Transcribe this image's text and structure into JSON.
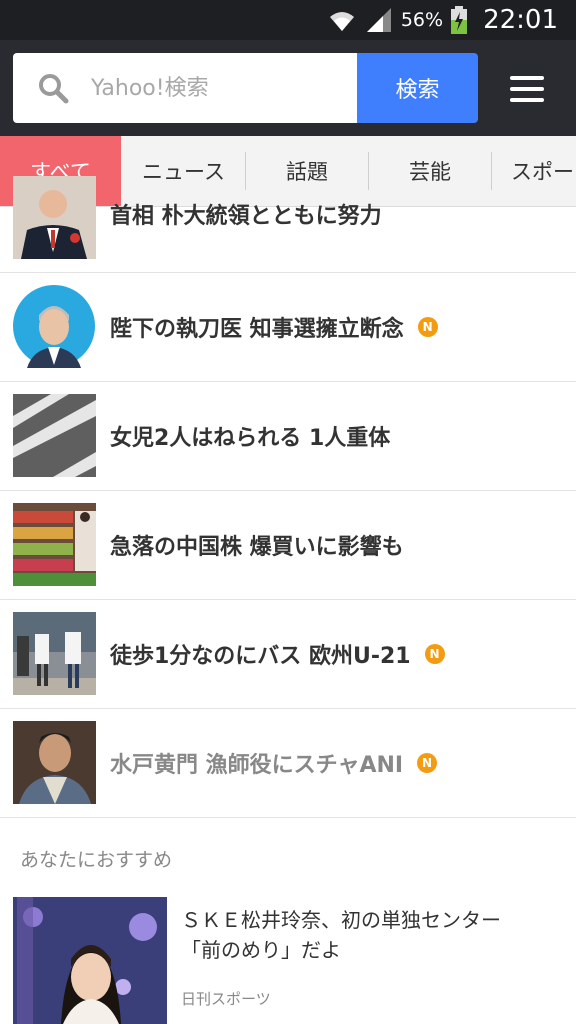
{
  "status_bar": {
    "battery_percent": "56%",
    "time": "22:01",
    "icons": [
      "wifi-icon",
      "signal-icon",
      "battery-charging-icon"
    ]
  },
  "search": {
    "placeholder": "Yahoo!検索",
    "value": "",
    "button_label": "検索"
  },
  "tabs": [
    {
      "label": "すべて",
      "active": true
    },
    {
      "label": "ニュース",
      "active": false
    },
    {
      "label": "話題",
      "active": false
    },
    {
      "label": "芸能",
      "active": false
    },
    {
      "label": "スポー",
      "active": false
    }
  ],
  "news": [
    {
      "title": "首相 朴大統領とともに努力",
      "is_new": false,
      "visited": false
    },
    {
      "title": "陛下の執刀医 知事選擁立断念",
      "is_new": true,
      "visited": false
    },
    {
      "title": "女児2人はねられる 1人重体",
      "is_new": false,
      "visited": false
    },
    {
      "title": "急落の中国株 爆買いに影響も",
      "is_new": false,
      "visited": false
    },
    {
      "title": "徒歩1分なのにバス 欧州U-21",
      "is_new": true,
      "visited": false
    },
    {
      "title": "水戸黄門 漁師役にスチャANI",
      "is_new": true,
      "visited": true
    }
  ],
  "new_badge_label": "N",
  "recommendations": {
    "heading": "あなたにおすすめ",
    "items": [
      {
        "title_line1": "ＳＫＥ松井玲奈、初の単独センター",
        "title_line2": "「前のめり」だよ",
        "source": "日刊スポーツ"
      }
    ]
  },
  "colors": {
    "header_bg": "#2a2b30",
    "search_button": "#3f7efc",
    "active_tab": "#f2656d",
    "new_badge": "#f39c12"
  }
}
